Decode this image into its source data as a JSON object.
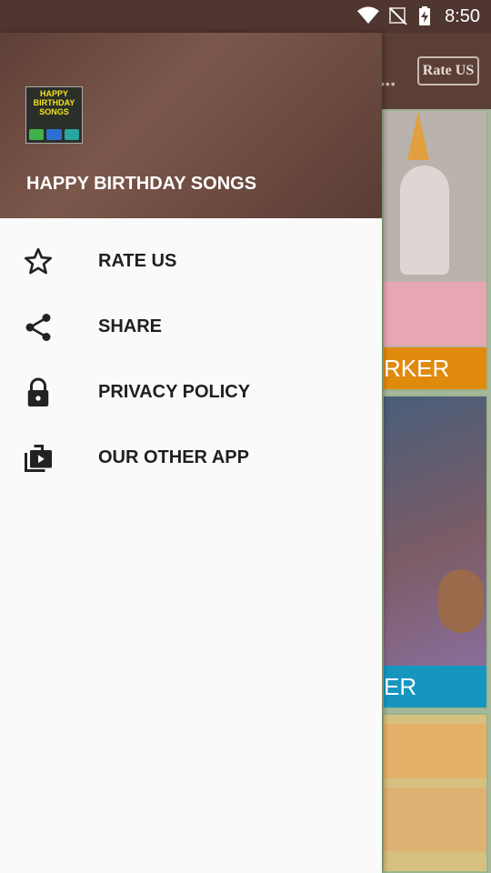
{
  "status_bar": {
    "time": "8:50"
  },
  "background_app": {
    "rate_button_label": "Rate US",
    "card1_band_text": "RKER",
    "card2_band_text": "ER",
    "card1_band_color": "#e08a0d",
    "card2_band_color": "#1696be"
  },
  "drawer": {
    "header_title": "HAPPY BIRTHDAY SONGS",
    "logo_text": "HAPPY BIRTHDAY SONGS",
    "items": [
      {
        "label": "RATE US",
        "icon": "star-outline-icon"
      },
      {
        "label": "SHARE",
        "icon": "share-icon"
      },
      {
        "label": "PRIVACY POLICY",
        "icon": "lock-icon"
      },
      {
        "label": "OUR OTHER APP",
        "icon": "shop-icon"
      }
    ]
  },
  "colors": {
    "header_brown": "#6d4c41",
    "drawer_bg": "#fafafa"
  }
}
